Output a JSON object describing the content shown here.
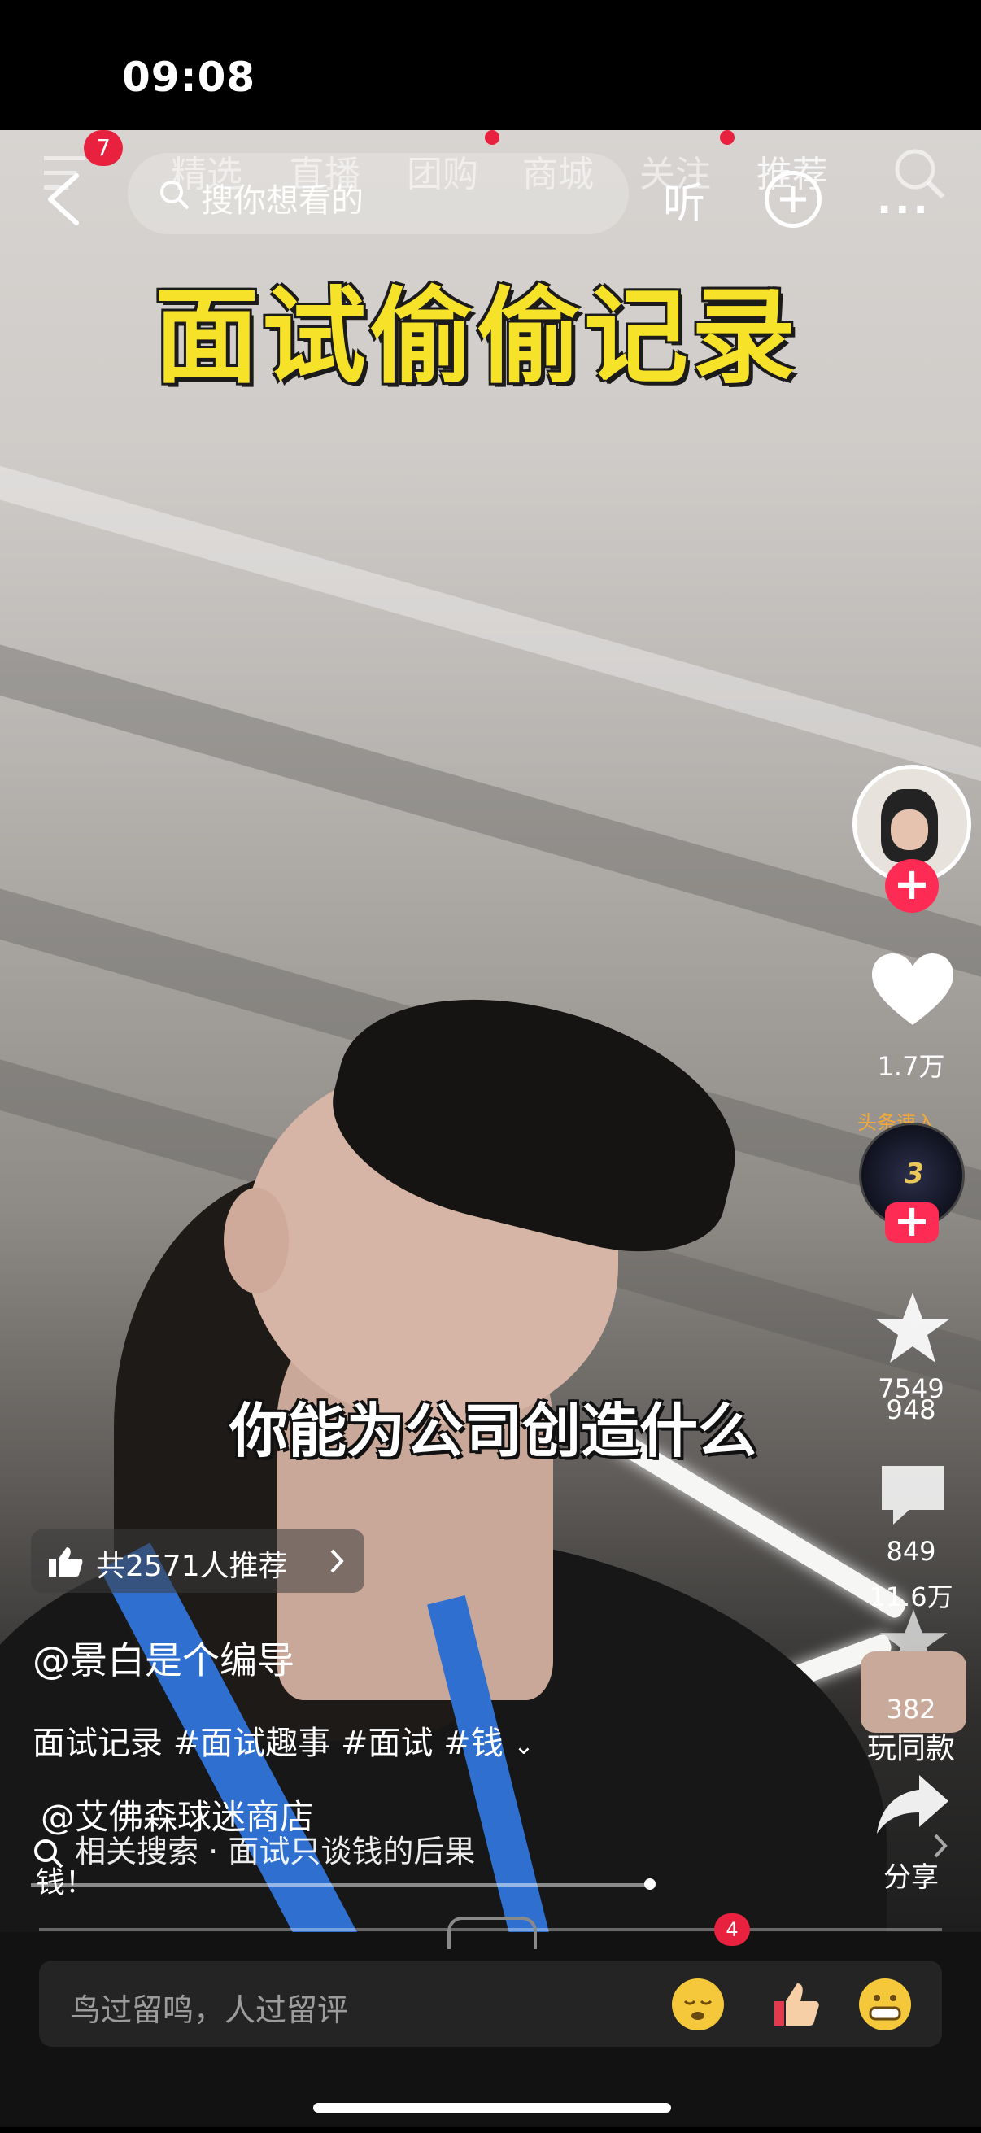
{
  "status_bar": {
    "time": "09:08"
  },
  "top_nav": {
    "menu_badge": "7",
    "tabs": [
      "精选",
      "直播",
      "团购",
      "商城",
      "关注",
      "推荐"
    ],
    "search_placeholder": "搜你想看的",
    "listen_label": "听",
    "more_label": "···"
  },
  "video": {
    "title_banner": "面试偷偷记录",
    "subtitle": "你能为公司创造什么"
  },
  "right_rail": {
    "like_count": "1.7万",
    "overlap_count_a": "7549",
    "overlap_count_b": "948",
    "comment_count": "849",
    "overlap_count_c": "11.6万",
    "overlap_count_d": "382",
    "play_same_label": "玩同款",
    "share_label": "分享",
    "music_disc_text": "3",
    "music_badge_text": "头条速入"
  },
  "info": {
    "recommend_text": "共2571人推荐",
    "author": "@景白是个编导",
    "description": "面试记录 #面试趣事 #面试 #钱",
    "shop": "@艾佛森球迷商店",
    "related_search": "相关搜索 · 面试只谈钱的后果",
    "money_suffix": "钱！"
  },
  "bottom": {
    "comment_placeholder": "鸟过留鸣，人过留评",
    "tab_badge": "4"
  },
  "colors": {
    "accent_red": "#fe2c55",
    "banner_yellow": "#f7e22a",
    "lanyard_blue": "#2f6fd0"
  }
}
